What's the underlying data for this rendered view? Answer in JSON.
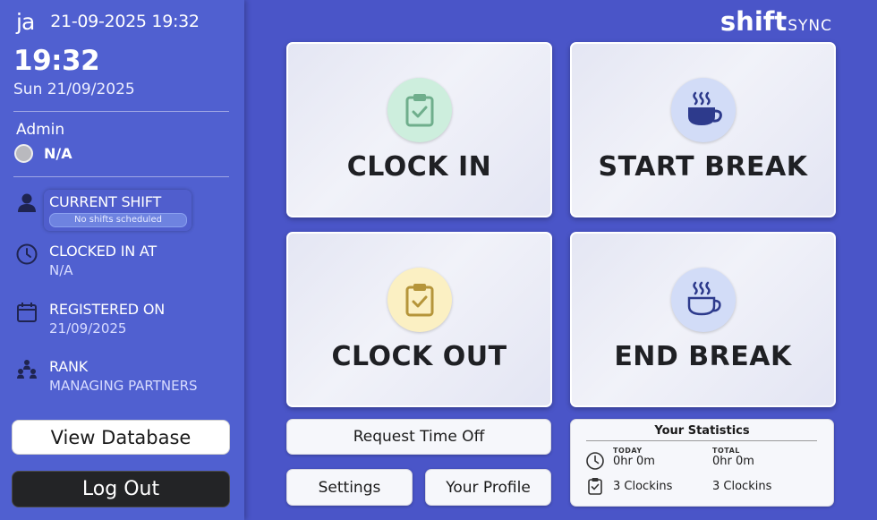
{
  "sidebar": {
    "logo": "ja",
    "header_datetime": "21-09-2025 19:32",
    "time": "19:32",
    "date": "Sun 21/09/2025",
    "user_role": "Admin",
    "status": "N/A",
    "status_color": "#b9b9be",
    "current_shift": {
      "label": "CURRENT SHIFT",
      "badge": "No shifts scheduled",
      "icon": "person-icon"
    },
    "clocked_in": {
      "label": "CLOCKED IN AT",
      "value": "N/A",
      "icon": "clock-icon"
    },
    "registered": {
      "label": "REGISTERED ON",
      "value": "21/09/2025",
      "icon": "calendar-icon"
    },
    "rank": {
      "label": "RANK",
      "value": "MANAGING PARTNERS",
      "icon": "hierarchy-icon"
    },
    "view_database": "View Database",
    "logout": "Log Out"
  },
  "brand": {
    "main": "shift",
    "sub": "SYNC"
  },
  "actions": {
    "clock_in": {
      "label": "CLOCK IN",
      "icon": "clipboard-check-icon",
      "color": "#cdeedd"
    },
    "start_break": {
      "label": "START BREAK",
      "icon": "coffee-cup-icon",
      "color": "#d2dcf7"
    },
    "clock_out": {
      "label": "CLOCK OUT",
      "icon": "clipboard-check-icon",
      "color": "#fbf0c3"
    },
    "end_break": {
      "label": "END BREAK",
      "icon": "coffee-cup-outline-icon",
      "color": "#d2dcf7"
    }
  },
  "buttons": {
    "request_time_off": "Request Time Off",
    "settings": "Settings",
    "your_profile": "Your Profile"
  },
  "stats": {
    "title": "Your Statistics",
    "today_caption": "TODAY",
    "today_hours": "0hr 0m",
    "today_clockins": "3 Clockins",
    "total_caption": "TOTAL",
    "total_hours": "0hr 0m",
    "total_clockins": "3 Clockins"
  }
}
